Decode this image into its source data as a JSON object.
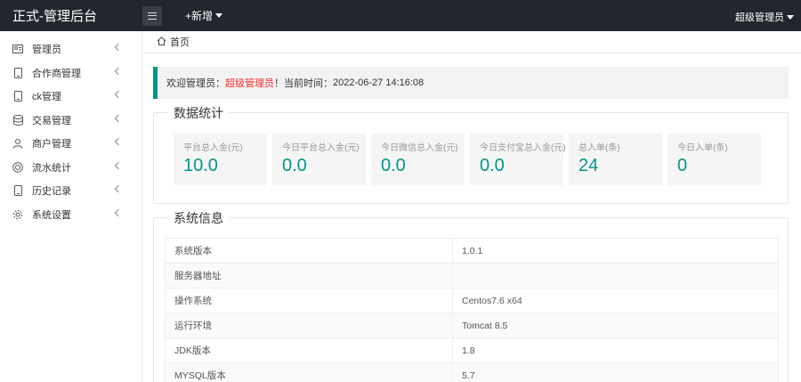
{
  "header": {
    "title": "正式-管理后台",
    "new_label": "+新增",
    "user_label": "超级管理员"
  },
  "sidebar": {
    "items": [
      {
        "label": "管理员",
        "icon": "id-card-icon"
      },
      {
        "label": "合作商管理",
        "icon": "phone-icon"
      },
      {
        "label": "ck管理",
        "icon": "phone-icon"
      },
      {
        "label": "交易管理",
        "icon": "database-icon"
      },
      {
        "label": "商户管理",
        "icon": "user-icon"
      },
      {
        "label": "流水统计",
        "icon": "target-icon"
      },
      {
        "label": "历史记录",
        "icon": "phone-icon"
      },
      {
        "label": "系统设置",
        "icon": "gear-icon"
      }
    ]
  },
  "breadcrumb": {
    "home": "首页"
  },
  "welcome": {
    "prefix": "欢迎管理员：",
    "name": "超级管理员",
    "mid": "！当前时间：",
    "time": "2022-06-27 14:16:08"
  },
  "stats": {
    "title": "数据统计",
    "cards": [
      {
        "label": "平台总入金(元)",
        "value": "10.0"
      },
      {
        "label": "今日平台总入金(元)",
        "value": "0.0"
      },
      {
        "label": "今日微信总入金(元)",
        "value": "0.0"
      },
      {
        "label": "今日支付宝总入金(元)",
        "value": "0.0"
      },
      {
        "label": "总入单(条)",
        "value": "24"
      },
      {
        "label": "今日入单(条)",
        "value": "0"
      }
    ]
  },
  "sysinfo": {
    "title": "系统信息",
    "rows": [
      {
        "key": "系统版本",
        "value": "1.0.1"
      },
      {
        "key": "服务器地址",
        "value": ""
      },
      {
        "key": "操作系统",
        "value": "Centos7.6 x64"
      },
      {
        "key": "运行环境",
        "value": "Tomcat 8.5"
      },
      {
        "key": "JDK版本",
        "value": "1.8"
      },
      {
        "key": "MYSQL版本",
        "value": "5.7"
      }
    ]
  },
  "colors": {
    "topbar": "#23262e",
    "accent": "#009688",
    "highlight": "#ff2d2d"
  }
}
